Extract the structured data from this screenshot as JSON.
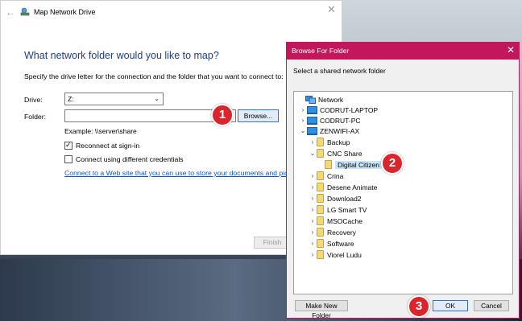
{
  "map_network_drive": {
    "title": "Map Network Drive",
    "heading": "What network folder would you like to map?",
    "instructions": "Specify the drive letter for the connection and the folder that you want to connect to:",
    "drive_label": "Drive:",
    "drive_value": "Z:",
    "folder_label": "Folder:",
    "folder_value": "",
    "browse_label": "Browse...",
    "example": "Example: \\\\server\\share",
    "reconnect_label": "Reconnect at sign-in",
    "reconnect_checked": true,
    "credentials_label": "Connect using different credentials",
    "credentials_checked": false,
    "web_link": "Connect to a Web site that you can use to store your documents and pictures.",
    "finish_label": "Finish"
  },
  "browse_for_folder": {
    "title": "Browse For Folder",
    "instructions": "Select a shared network folder",
    "tree": [
      {
        "label": "Network",
        "icon": "network-icon",
        "expander": ""
      },
      {
        "label": "CODRUT-LAPTOP",
        "icon": "computer-icon",
        "expander": "collapsed"
      },
      {
        "label": "CODRUT-PC",
        "icon": "computer-icon",
        "expander": "collapsed"
      },
      {
        "label": "ZENWIFI-AX",
        "icon": "computer-icon",
        "expander": "expanded"
      },
      {
        "label": "Backup",
        "icon": "folder-icon",
        "expander": "collapsed"
      },
      {
        "label": "CNC Share",
        "icon": "folder-icon",
        "expander": "expanded"
      },
      {
        "label": "Digital Citizen",
        "icon": "folder-icon",
        "expander": "",
        "selected": true
      },
      {
        "label": "Crina",
        "icon": "folder-icon",
        "expander": "collapsed"
      },
      {
        "label": "Desene Animate",
        "icon": "folder-icon",
        "expander": "collapsed"
      },
      {
        "label": "Download2",
        "icon": "folder-icon",
        "expander": "collapsed"
      },
      {
        "label": "LG Smart TV",
        "icon": "folder-icon",
        "expander": "collapsed"
      },
      {
        "label": "MSOCache",
        "icon": "folder-icon",
        "expander": "collapsed"
      },
      {
        "label": "Recovery",
        "icon": "folder-icon",
        "expander": "collapsed"
      },
      {
        "label": "Software",
        "icon": "folder-icon",
        "expander": "collapsed"
      },
      {
        "label": "Viorel Ludu",
        "icon": "folder-icon",
        "expander": "collapsed"
      }
    ],
    "make_new_folder_label": "Make New Folder",
    "ok_label": "OK",
    "cancel_label": "Cancel"
  },
  "step_badges": [
    "1",
    "2",
    "3"
  ],
  "colors": {
    "dialog_accent": "#c2185b",
    "heading_blue": "#1a3e8c",
    "link_blue": "#0b57c8",
    "badge_red": "#d9252b",
    "selection": "#cce4f7"
  }
}
